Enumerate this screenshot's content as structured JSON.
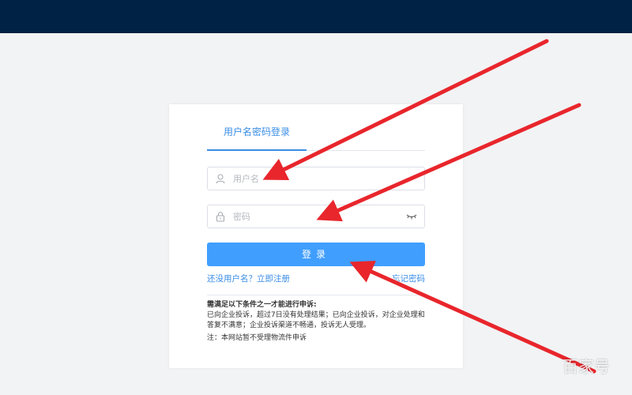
{
  "login": {
    "tab_label": "用户名密码登录",
    "username_placeholder": "用户名",
    "password_placeholder": "密码",
    "submit_label": "登录",
    "register_link": "还没用户名？立即注册",
    "forgot_link": "忘记密码"
  },
  "notice": {
    "title": "需满足以下条件之一才能进行申诉:",
    "body": "已向企业投诉，超过7日没有处理结果；已向企业投诉，对企业处理和答复不满意；企业投诉渠道不畅通，投诉无人受理。",
    "note": "注：本网站暂不受理物流件申诉"
  },
  "watermark": "百家号",
  "colors": {
    "header": "#002244",
    "accent": "#409eff",
    "arrow": "#e8262c"
  }
}
